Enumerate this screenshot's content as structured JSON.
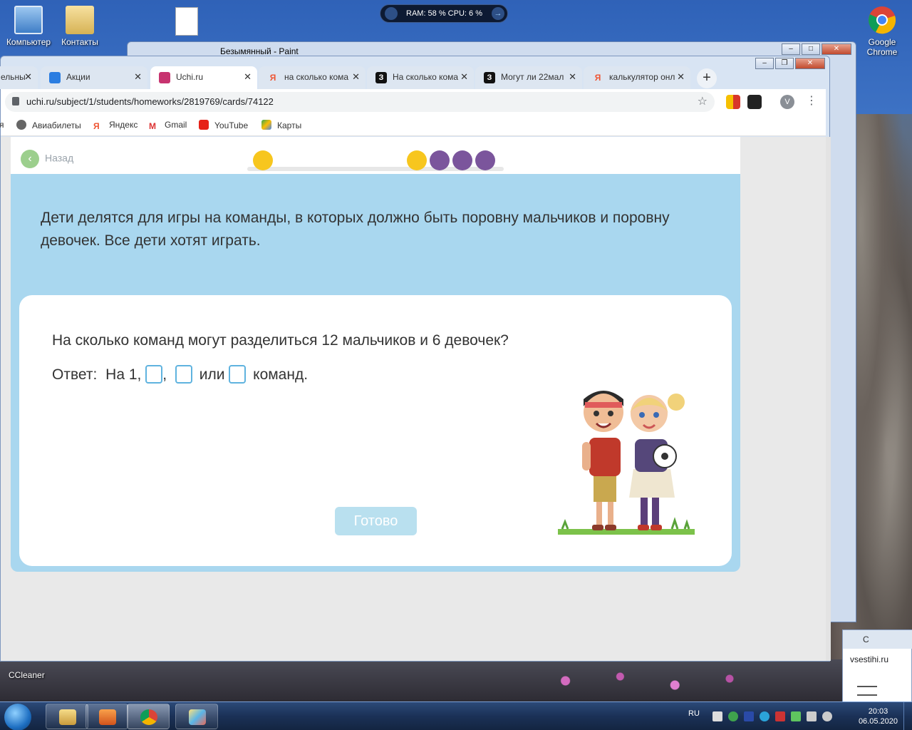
{
  "desktop": {
    "icons": [
      {
        "label": "Компьютер"
      },
      {
        "label": "Контакты"
      },
      {
        "label": ""
      }
    ],
    "chrome_shortcut": {
      "line1": "Google",
      "line2": "Chrome"
    },
    "ccleaner": "CCleaner"
  },
  "gadget": {
    "text": "RAM: 58 %  CPU: 6 %"
  },
  "paint": {
    "title": "Безымянный - Paint"
  },
  "chrome": {
    "tabs": [
      {
        "title": "ельны",
        "active": false
      },
      {
        "title": "Акции",
        "active": false
      },
      {
        "title": "Uchi.ru",
        "active": true
      },
      {
        "title": "на сколько кома",
        "active": false
      },
      {
        "title": "На сколько кома",
        "active": false
      },
      {
        "title": "Могут ли 22мал",
        "active": false
      },
      {
        "title": "калькулятор онл",
        "active": false
      }
    ],
    "new_tab": "+",
    "url": "uchi.ru/subject/1/students/homeworks/2819769/cards/74122",
    "avatar_letter": "V",
    "bookmarks": [
      {
        "label": "я"
      },
      {
        "label": "Авиабилеты"
      },
      {
        "label": "Яндекс"
      },
      {
        "label": "Gmail"
      },
      {
        "label": "YouTube"
      },
      {
        "label": "Карты"
      }
    ]
  },
  "lesson": {
    "back_label": "Назад",
    "progress": {
      "done": 2,
      "total": 5
    },
    "intro": "Дети делятся для игры на команды, в которых должно быть поровну мальчиков и поровну девочек. Все дети хотят играть.",
    "question": "На сколько команд могут разделиться 12 мальчиков и 6 девочек?",
    "answer": {
      "label": "Ответ:",
      "prefix": "На 1,",
      "sep1": ",",
      "sep2": "или",
      "suffix": "команд.",
      "blanks": [
        "",
        "",
        ""
      ]
    },
    "submit_label": "Готово"
  },
  "mini_window": {
    "tab": "С",
    "url": "vsestihi.ru"
  },
  "taskbar": {
    "lang": "RU",
    "time": "20:03",
    "date": "06.05.2020"
  },
  "colors": {
    "lesson_bg": "#a9d7ef",
    "progress_done": "#f7c61e",
    "progress_todo": "#7b559c",
    "blank_border": "#5fb3df",
    "submit_disabled": "#b9e0ef"
  }
}
